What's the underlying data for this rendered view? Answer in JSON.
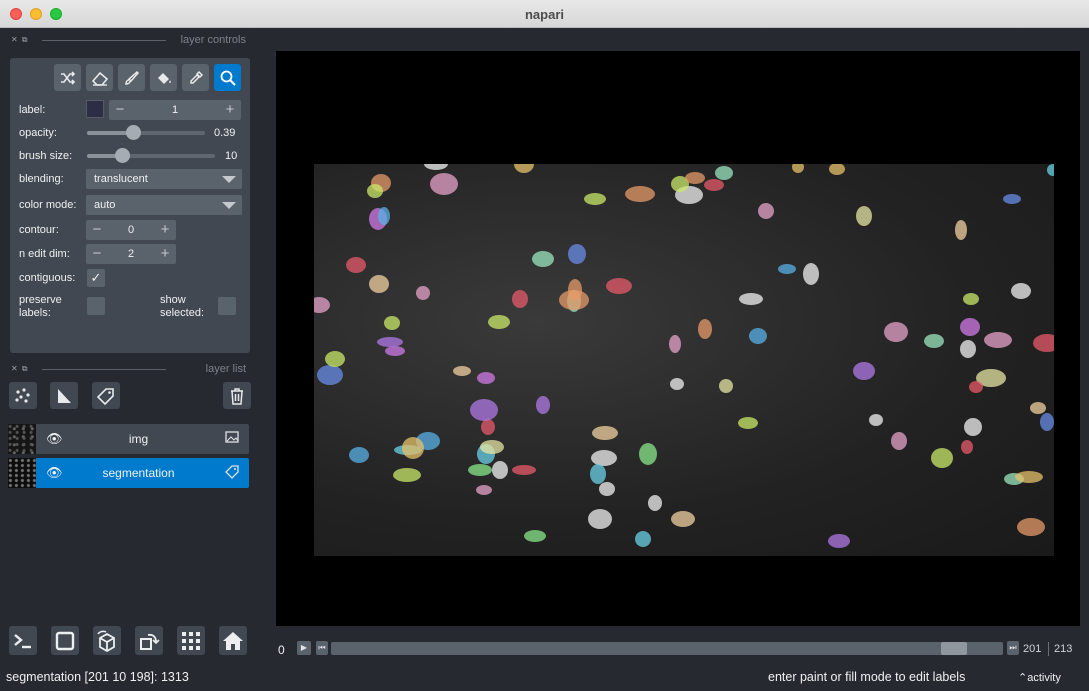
{
  "window": {
    "title": "napari"
  },
  "docks": {
    "layer_controls_title": "layer controls",
    "layer_list_title": "layer list"
  },
  "tools": [
    {
      "name": "shuffle-colors-icon",
      "glyph": "⤨"
    },
    {
      "name": "eraser-icon",
      "glyph": "⌫"
    },
    {
      "name": "paintbrush-icon",
      "glyph": "✎"
    },
    {
      "name": "fill-bucket-icon",
      "glyph": "◭"
    },
    {
      "name": "color-picker-icon",
      "glyph": "✒"
    },
    {
      "name": "zoom-icon",
      "glyph": "⚲"
    }
  ],
  "controls": {
    "label": {
      "label": "label:",
      "value": "1",
      "swatch": "#2b2e45"
    },
    "opacity": {
      "label": "opacity:",
      "value": "0.39",
      "fraction": 0.39
    },
    "brush_size": {
      "label": "brush size:",
      "value": "10",
      "fraction": 0.27
    },
    "blending": {
      "label": "blending:",
      "value": "translucent"
    },
    "color_mode": {
      "label": "color mode:",
      "value": "auto"
    },
    "contour": {
      "label": "contour:",
      "value": "0"
    },
    "n_edit_dim": {
      "label": "n edit dim:",
      "value": "2"
    },
    "contiguous": {
      "label": "contiguous:",
      "checked": true,
      "mark": "✓"
    },
    "preserve_labels": {
      "line1": "preserve",
      "line2": "labels:",
      "checked": false
    },
    "show_selected": {
      "line1": "show",
      "line2": "selected:",
      "checked": false
    }
  },
  "layers": [
    {
      "name": "img",
      "type_icon": "image-icon",
      "selected": false
    },
    {
      "name": "segmentation",
      "type_icon": "labels-icon",
      "selected": true
    }
  ],
  "dims": {
    "current_label": "0",
    "slider_value": 201,
    "max_value": 213,
    "cur": "201",
    "max": "213"
  },
  "status": {
    "left": "segmentation [201  10 198]: 1313",
    "right": "enter paint or fill mode to edit labels",
    "activity": "activity"
  },
  "colors": {
    "accent": "#007acc",
    "panel": "#414851",
    "background": "#262930"
  }
}
